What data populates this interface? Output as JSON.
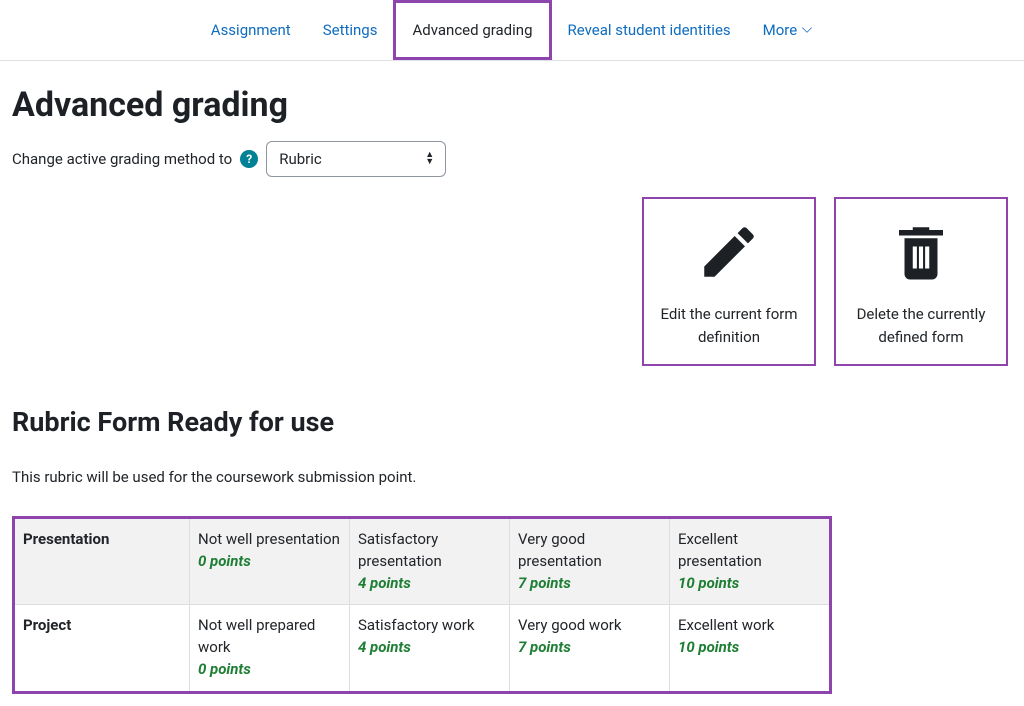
{
  "nav": {
    "items": [
      {
        "label": "Assignment",
        "active": false
      },
      {
        "label": "Settings",
        "active": false
      },
      {
        "label": "Advanced grading",
        "active": true
      },
      {
        "label": "Reveal student identities",
        "active": false
      },
      {
        "label": "More",
        "active": false,
        "dropdown": true
      }
    ]
  },
  "page": {
    "title": "Advanced grading",
    "method_label": "Change active grading method to",
    "method_value": "Rubric"
  },
  "actions": {
    "edit": {
      "label": "Edit the current form definition"
    },
    "delete": {
      "label": "Delete the currently defined form"
    }
  },
  "rubric": {
    "heading": "Rubric Form Ready for use",
    "description": "This rubric will be used for the coursework submission point.",
    "criteria": [
      {
        "name": "Presentation",
        "levels": [
          {
            "desc": "Not well presentation",
            "points": "0 points"
          },
          {
            "desc": "Satisfactory presentation",
            "points": "4 points"
          },
          {
            "desc": "Very good presentation",
            "points": "7 points"
          },
          {
            "desc": "Excellent presentation",
            "points": "10 points"
          }
        ]
      },
      {
        "name": "Project",
        "levels": [
          {
            "desc": "Not well prepared work",
            "points": "0 points"
          },
          {
            "desc": "Satisfactory work",
            "points": "4 points"
          },
          {
            "desc": "Very good work",
            "points": "7 points"
          },
          {
            "desc": "Excellent work",
            "points": "10 points"
          }
        ]
      }
    ]
  }
}
